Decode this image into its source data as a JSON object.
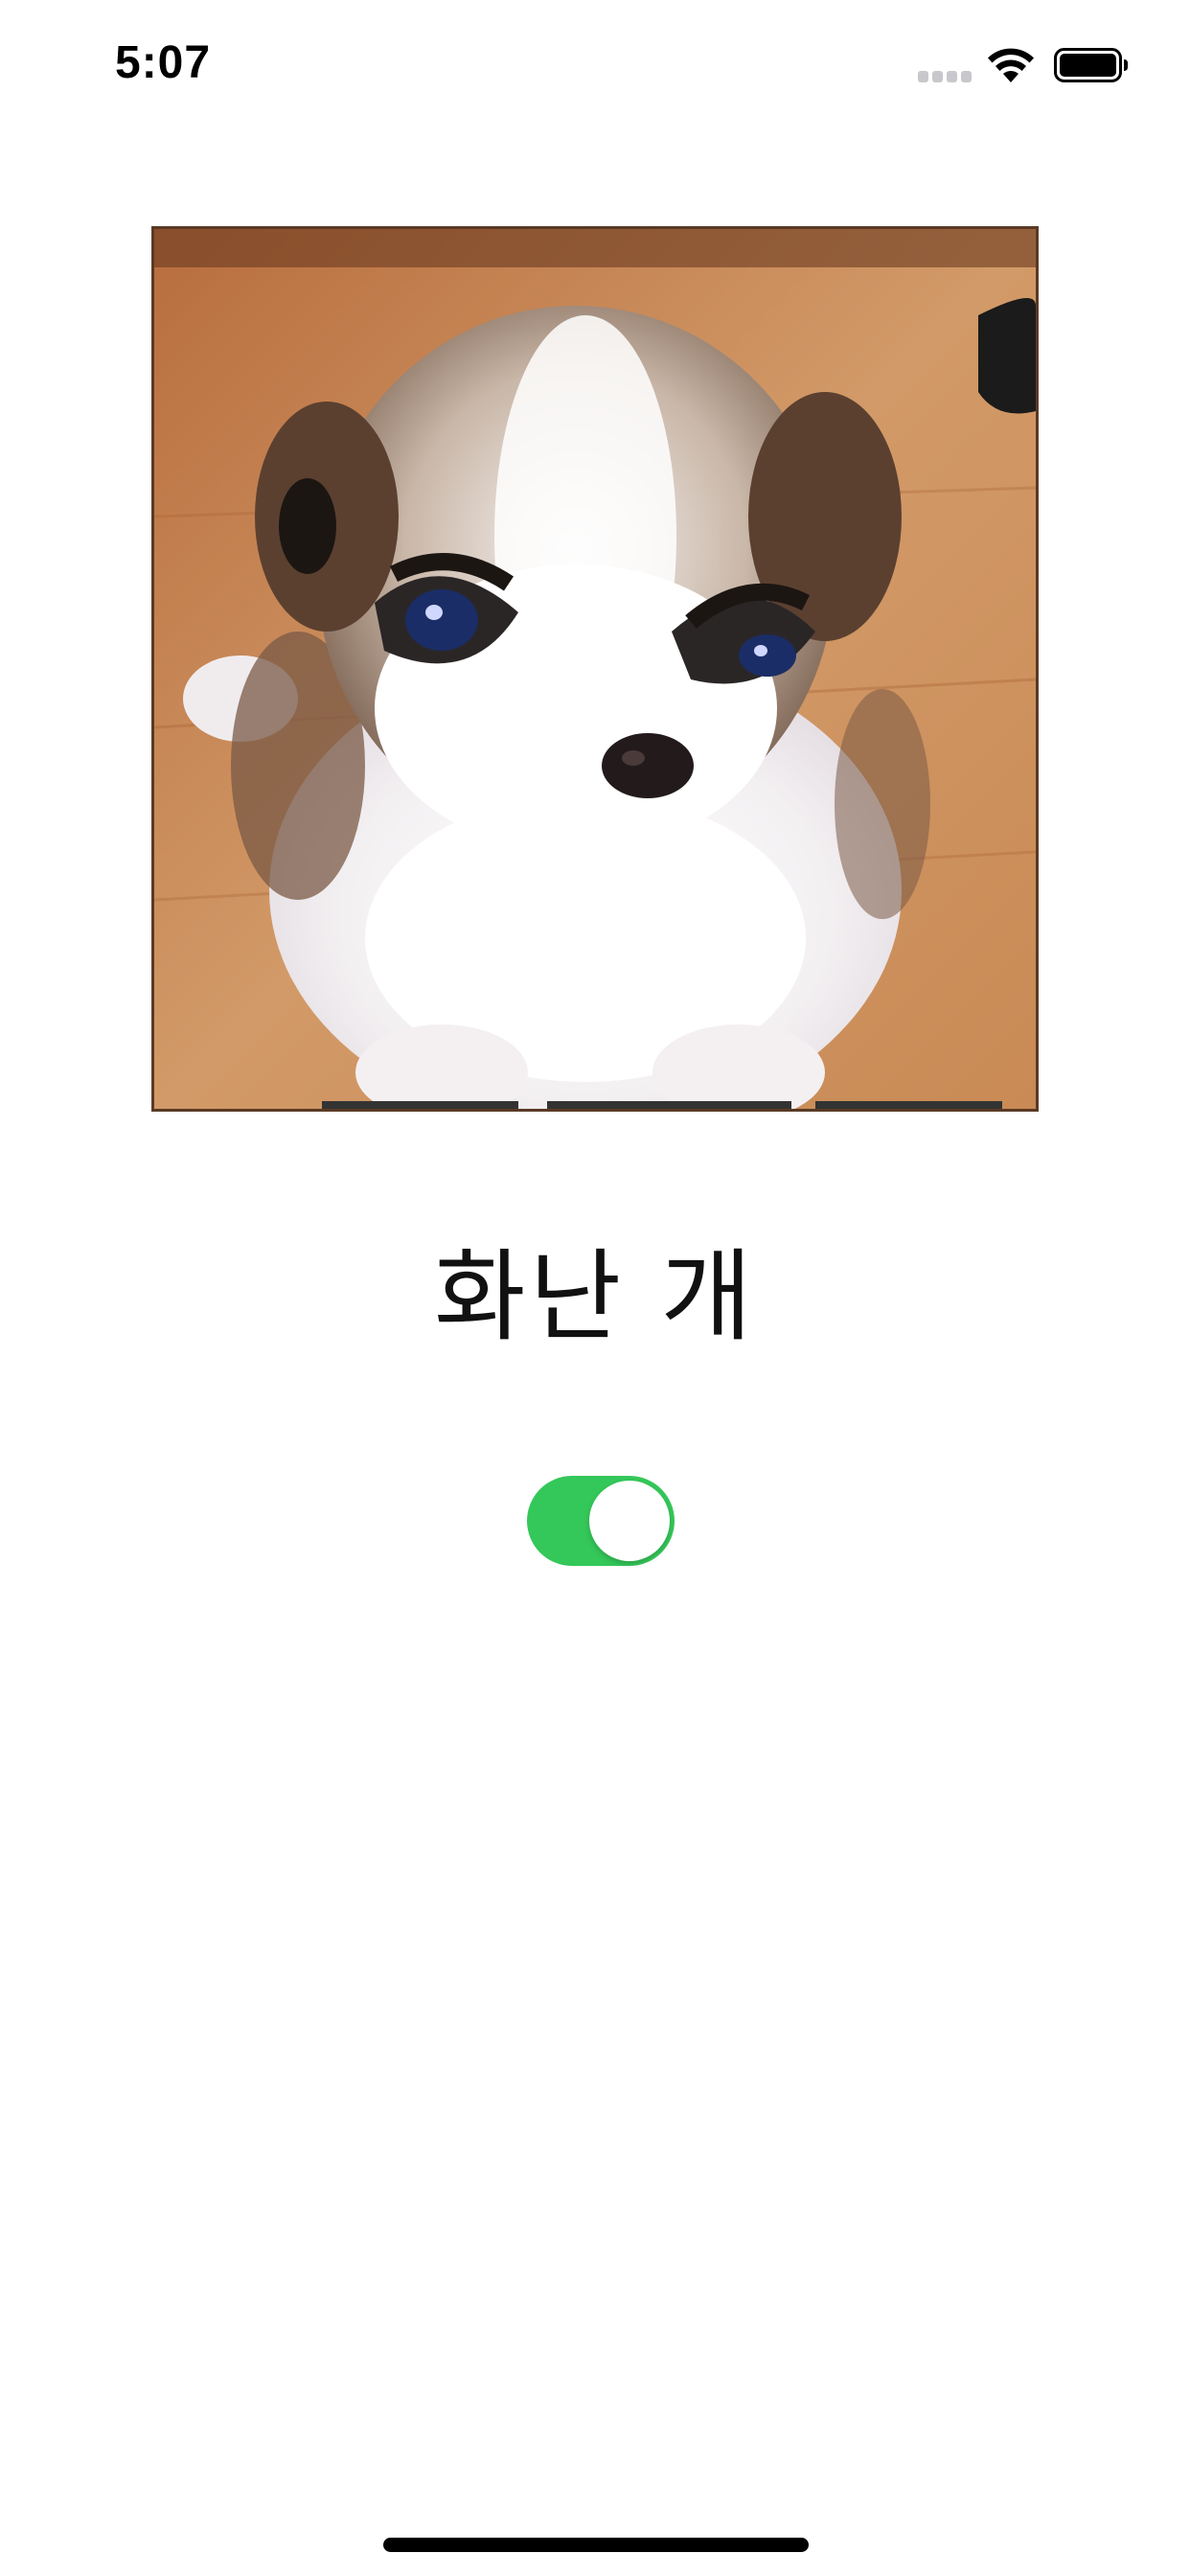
{
  "status_bar": {
    "time": "5:07",
    "signal_icon": "cellular-signal-icon",
    "wifi_icon": "wifi-icon",
    "battery_icon": "battery-icon"
  },
  "photo": {
    "subject": "angry-puppy-photo"
  },
  "title": "화난 개",
  "toggle": {
    "state": "on",
    "on_color": "#34c759"
  }
}
